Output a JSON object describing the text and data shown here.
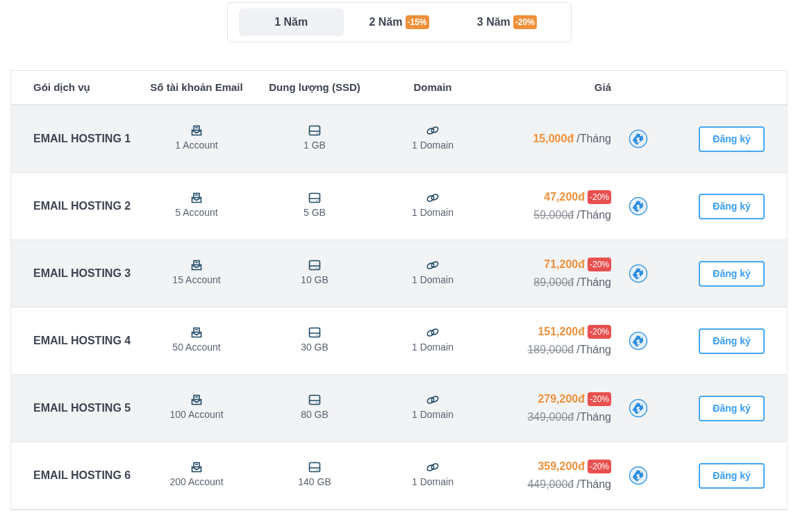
{
  "tabs": [
    {
      "label": "1 Năm",
      "selected": true
    },
    {
      "label": "2 Năm",
      "badge": "-15%",
      "selected": false
    },
    {
      "label": "3 Năm",
      "badge": "-20%",
      "selected": false
    }
  ],
  "table": {
    "columns": [
      "Gói dịch vụ",
      "Số tài khoản Email",
      "Dung lượng (SSD)",
      "Domain",
      "Giá"
    ],
    "rows": [
      {
        "name": "EMAIL HOSTING 1",
        "accounts": "1 Account",
        "storage": "1 GB",
        "domains": "1 Domain",
        "price": "15,000đ",
        "discount": null,
        "old_price": null,
        "unit": "/Tháng",
        "button": "Đăng ký"
      },
      {
        "name": "EMAIL HOSTING 2",
        "accounts": "5 Account",
        "storage": "5 GB",
        "domains": "1 Domain",
        "price": "47,200đ",
        "discount": "-20%",
        "old_price": "59,000đ",
        "unit": "/Tháng",
        "button": "Đăng ký"
      },
      {
        "name": "EMAIL HOSTING 3",
        "accounts": "15 Account",
        "storage": "10 GB",
        "domains": "1 Domain",
        "price": "71,200đ",
        "discount": "-20%",
        "old_price": "89,000đ",
        "unit": "/Tháng",
        "button": "Đăng ký"
      },
      {
        "name": "EMAIL HOSTING 4",
        "accounts": "50 Account",
        "storage": "30 GB",
        "domains": "1 Domain",
        "price": "151,200đ",
        "discount": "-20%",
        "old_price": "189,000đ",
        "unit": "/Tháng",
        "button": "Đăng ký"
      },
      {
        "name": "EMAIL HOSTING 5",
        "accounts": "100 Account",
        "storage": "80 GB",
        "domains": "1 Domain",
        "price": "279,200đ",
        "discount": "-20%",
        "old_price": "349,000đ",
        "unit": "/Tháng",
        "button": "Đăng ký"
      },
      {
        "name": "EMAIL HOSTING 6",
        "accounts": "200 Account",
        "storage": "140 GB",
        "domains": "1 Domain",
        "price": "359,200đ",
        "discount": "-20%",
        "old_price": "449,000đ",
        "unit": "/Tháng",
        "button": "Đăng ký"
      }
    ]
  }
}
